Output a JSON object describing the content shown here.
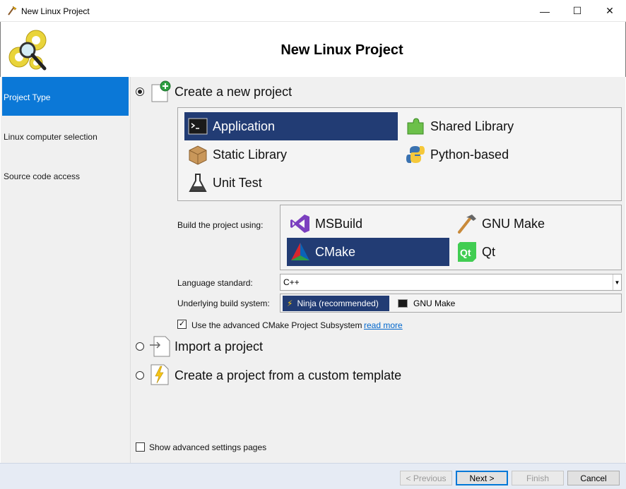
{
  "window": {
    "title": "New Linux Project",
    "minimize": "—",
    "maximize": "☐",
    "close": "✕"
  },
  "header": {
    "heading": "New Linux Project"
  },
  "sidebar": {
    "items": [
      {
        "label": "Project Type"
      },
      {
        "label": "Linux computer selection"
      },
      {
        "label": "Source code access"
      }
    ]
  },
  "content": {
    "create_new": "Create a new project",
    "project_types": [
      {
        "label": "Application",
        "icon": "terminal-icon"
      },
      {
        "label": "Shared Library",
        "icon": "puzzle-icon"
      },
      {
        "label": "Static Library",
        "icon": "box-icon"
      },
      {
        "label": "Python-based",
        "icon": "python-icon"
      },
      {
        "label": "Unit Test",
        "icon": "flask-icon"
      }
    ],
    "build_using_label": "Build the project using:",
    "build_tools": [
      {
        "label": "MSBuild",
        "icon": "visual-studio-icon"
      },
      {
        "label": "GNU Make",
        "icon": "hammer-icon"
      },
      {
        "label": "CMake",
        "icon": "cmake-icon"
      },
      {
        "label": "Qt",
        "icon": "qt-icon"
      }
    ],
    "language_standard_label": "Language standard:",
    "language_standard_value": "C++",
    "build_system_label": "Underlying build system:",
    "build_systems": [
      {
        "label": "Ninja (recommended)"
      },
      {
        "label": "GNU Make"
      }
    ],
    "cmake_subsystem_label": "Use the advanced CMake Project Subsystem",
    "cmake_subsystem_checked": true,
    "read_more": "read more",
    "import_project": "Import a project",
    "custom_template": "Create a project from a custom template",
    "show_advanced": "Show advanced settings pages"
  },
  "footer": {
    "previous": "< Previous",
    "next": "Next >",
    "finish": "Finish",
    "cancel": "Cancel"
  },
  "colors": {
    "selection": "#223c74",
    "sidebar_active": "#0b78d7",
    "link": "#0066cc"
  }
}
